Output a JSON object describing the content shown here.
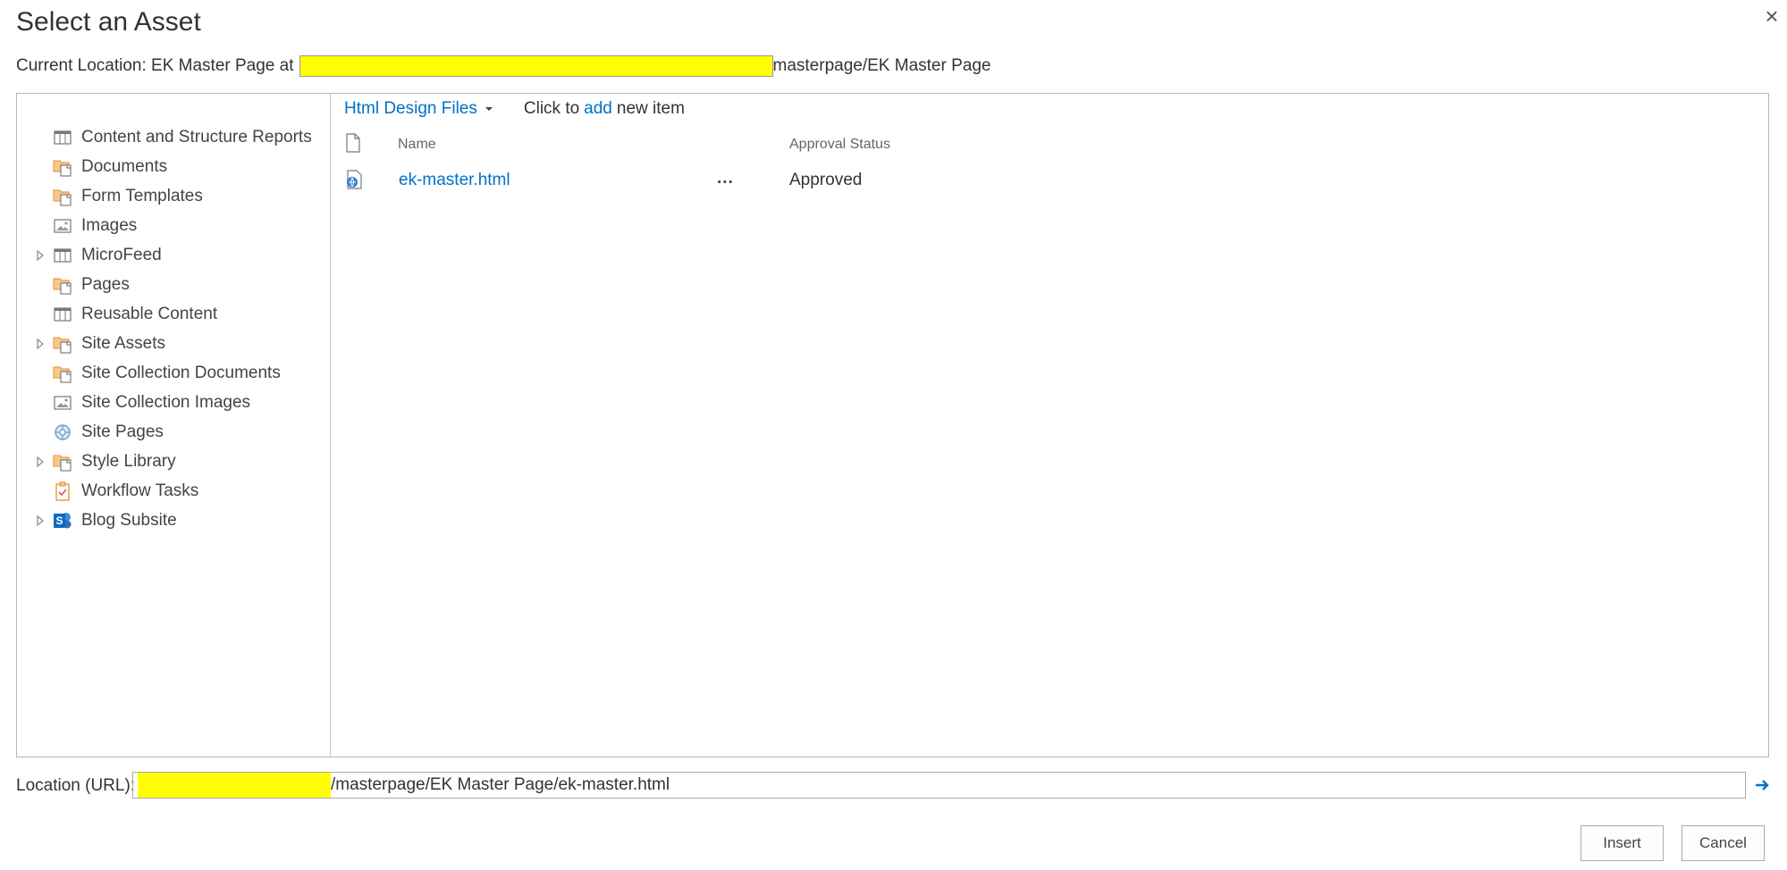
{
  "dialog": {
    "title": "Select an Asset",
    "close_symbol": "×"
  },
  "current_location": {
    "prefix": "Current Location: EK Master Page at",
    "suffix": "masterpage/EK Master Page"
  },
  "tree": {
    "items": [
      {
        "label": "Content and Structure Reports",
        "icon": "list-icon",
        "expandable": false
      },
      {
        "label": "Documents",
        "icon": "document-library-icon",
        "expandable": false
      },
      {
        "label": "Form Templates",
        "icon": "document-library-icon",
        "expandable": false
      },
      {
        "label": "Images",
        "icon": "image-library-icon",
        "expandable": false
      },
      {
        "label": "MicroFeed",
        "icon": "list-icon",
        "expandable": true
      },
      {
        "label": "Pages",
        "icon": "document-library-icon",
        "expandable": false
      },
      {
        "label": "Reusable Content",
        "icon": "list-icon",
        "expandable": false
      },
      {
        "label": "Site Assets",
        "icon": "document-library-icon",
        "expandable": true
      },
      {
        "label": "Site Collection Documents",
        "icon": "document-library-icon",
        "expandable": false
      },
      {
        "label": "Site Collection Images",
        "icon": "image-library-icon",
        "expandable": false
      },
      {
        "label": "Site Pages",
        "icon": "wiki-pages-icon",
        "expandable": false
      },
      {
        "label": "Style Library",
        "icon": "document-library-icon",
        "expandable": true
      },
      {
        "label": "Workflow Tasks",
        "icon": "tasks-icon",
        "expandable": false
      },
      {
        "label": "Blog Subsite",
        "icon": "sharepoint-site-icon",
        "expandable": true
      }
    ]
  },
  "view_bar": {
    "view_name": "Html Design Files",
    "click_to": "Click to",
    "add_link": "add",
    "new_item": "new item"
  },
  "table": {
    "columns": {
      "name": "Name",
      "status": "Approval Status"
    },
    "rows": [
      {
        "name": "ek-master.html",
        "ellipsis": "...",
        "status": "Approved"
      }
    ]
  },
  "location_url": {
    "label": "Location (URL):",
    "value_suffix": "/masterpage/EK Master Page/ek-master.html"
  },
  "buttons": {
    "insert": "Insert",
    "cancel": "Cancel"
  },
  "colors": {
    "link": "#0072c6",
    "redaction": "#ffff00",
    "border": "#b8b8b8",
    "library_orange": "#f0a040"
  }
}
